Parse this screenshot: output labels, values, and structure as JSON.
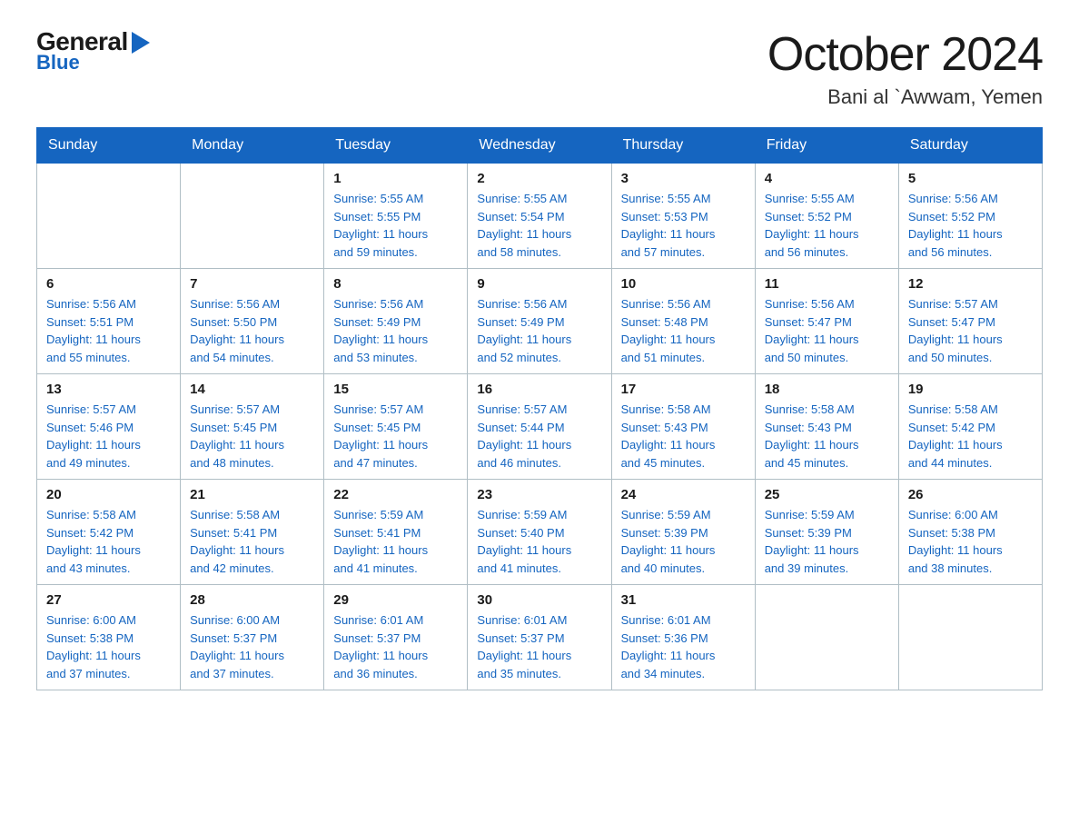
{
  "logo": {
    "general": "General",
    "blue": "Blue"
  },
  "title": "October 2024",
  "subtitle": "Bani al `Awwam, Yemen",
  "weekdays": [
    "Sunday",
    "Monday",
    "Tuesday",
    "Wednesday",
    "Thursday",
    "Friday",
    "Saturday"
  ],
  "weeks": [
    [
      {
        "day": "",
        "info": ""
      },
      {
        "day": "",
        "info": ""
      },
      {
        "day": "1",
        "info": "Sunrise: 5:55 AM\nSunset: 5:55 PM\nDaylight: 11 hours\nand 59 minutes."
      },
      {
        "day": "2",
        "info": "Sunrise: 5:55 AM\nSunset: 5:54 PM\nDaylight: 11 hours\nand 58 minutes."
      },
      {
        "day": "3",
        "info": "Sunrise: 5:55 AM\nSunset: 5:53 PM\nDaylight: 11 hours\nand 57 minutes."
      },
      {
        "day": "4",
        "info": "Sunrise: 5:55 AM\nSunset: 5:52 PM\nDaylight: 11 hours\nand 56 minutes."
      },
      {
        "day": "5",
        "info": "Sunrise: 5:56 AM\nSunset: 5:52 PM\nDaylight: 11 hours\nand 56 minutes."
      }
    ],
    [
      {
        "day": "6",
        "info": "Sunrise: 5:56 AM\nSunset: 5:51 PM\nDaylight: 11 hours\nand 55 minutes."
      },
      {
        "day": "7",
        "info": "Sunrise: 5:56 AM\nSunset: 5:50 PM\nDaylight: 11 hours\nand 54 minutes."
      },
      {
        "day": "8",
        "info": "Sunrise: 5:56 AM\nSunset: 5:49 PM\nDaylight: 11 hours\nand 53 minutes."
      },
      {
        "day": "9",
        "info": "Sunrise: 5:56 AM\nSunset: 5:49 PM\nDaylight: 11 hours\nand 52 minutes."
      },
      {
        "day": "10",
        "info": "Sunrise: 5:56 AM\nSunset: 5:48 PM\nDaylight: 11 hours\nand 51 minutes."
      },
      {
        "day": "11",
        "info": "Sunrise: 5:56 AM\nSunset: 5:47 PM\nDaylight: 11 hours\nand 50 minutes."
      },
      {
        "day": "12",
        "info": "Sunrise: 5:57 AM\nSunset: 5:47 PM\nDaylight: 11 hours\nand 50 minutes."
      }
    ],
    [
      {
        "day": "13",
        "info": "Sunrise: 5:57 AM\nSunset: 5:46 PM\nDaylight: 11 hours\nand 49 minutes."
      },
      {
        "day": "14",
        "info": "Sunrise: 5:57 AM\nSunset: 5:45 PM\nDaylight: 11 hours\nand 48 minutes."
      },
      {
        "day": "15",
        "info": "Sunrise: 5:57 AM\nSunset: 5:45 PM\nDaylight: 11 hours\nand 47 minutes."
      },
      {
        "day": "16",
        "info": "Sunrise: 5:57 AM\nSunset: 5:44 PM\nDaylight: 11 hours\nand 46 minutes."
      },
      {
        "day": "17",
        "info": "Sunrise: 5:58 AM\nSunset: 5:43 PM\nDaylight: 11 hours\nand 45 minutes."
      },
      {
        "day": "18",
        "info": "Sunrise: 5:58 AM\nSunset: 5:43 PM\nDaylight: 11 hours\nand 45 minutes."
      },
      {
        "day": "19",
        "info": "Sunrise: 5:58 AM\nSunset: 5:42 PM\nDaylight: 11 hours\nand 44 minutes."
      }
    ],
    [
      {
        "day": "20",
        "info": "Sunrise: 5:58 AM\nSunset: 5:42 PM\nDaylight: 11 hours\nand 43 minutes."
      },
      {
        "day": "21",
        "info": "Sunrise: 5:58 AM\nSunset: 5:41 PM\nDaylight: 11 hours\nand 42 minutes."
      },
      {
        "day": "22",
        "info": "Sunrise: 5:59 AM\nSunset: 5:41 PM\nDaylight: 11 hours\nand 41 minutes."
      },
      {
        "day": "23",
        "info": "Sunrise: 5:59 AM\nSunset: 5:40 PM\nDaylight: 11 hours\nand 41 minutes."
      },
      {
        "day": "24",
        "info": "Sunrise: 5:59 AM\nSunset: 5:39 PM\nDaylight: 11 hours\nand 40 minutes."
      },
      {
        "day": "25",
        "info": "Sunrise: 5:59 AM\nSunset: 5:39 PM\nDaylight: 11 hours\nand 39 minutes."
      },
      {
        "day": "26",
        "info": "Sunrise: 6:00 AM\nSunset: 5:38 PM\nDaylight: 11 hours\nand 38 minutes."
      }
    ],
    [
      {
        "day": "27",
        "info": "Sunrise: 6:00 AM\nSunset: 5:38 PM\nDaylight: 11 hours\nand 37 minutes."
      },
      {
        "day": "28",
        "info": "Sunrise: 6:00 AM\nSunset: 5:37 PM\nDaylight: 11 hours\nand 37 minutes."
      },
      {
        "day": "29",
        "info": "Sunrise: 6:01 AM\nSunset: 5:37 PM\nDaylight: 11 hours\nand 36 minutes."
      },
      {
        "day": "30",
        "info": "Sunrise: 6:01 AM\nSunset: 5:37 PM\nDaylight: 11 hours\nand 35 minutes."
      },
      {
        "day": "31",
        "info": "Sunrise: 6:01 AM\nSunset: 5:36 PM\nDaylight: 11 hours\nand 34 minutes."
      },
      {
        "day": "",
        "info": ""
      },
      {
        "day": "",
        "info": ""
      }
    ]
  ]
}
